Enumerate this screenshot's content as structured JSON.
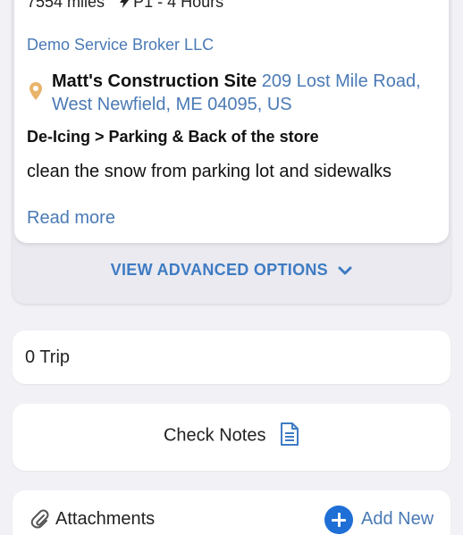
{
  "work_order": {
    "distance": "7554 miles",
    "priority": "P1 - 4 Hours",
    "broker": "Demo Service Broker LLC",
    "site_name": "Matt's Construction Site",
    "site_address": "209 Lost Mile Road, West Newfield, ME 04095, US",
    "service": "De-Icing > Parking & Back of the store",
    "description": "clean the snow from parking lot and sidewalks",
    "read_more": "Read more"
  },
  "advanced_options": {
    "label": "VIEW ADVANCED OPTIONS",
    "icon": "chevron-down-icon"
  },
  "trip": {
    "label": "0 Trip"
  },
  "notes": {
    "label": "Check Notes",
    "icon": "document-icon"
  },
  "attachments": {
    "label": "Attachments",
    "icon": "paperclip-icon",
    "add_label": "Add New",
    "add_icon": "plus-circle-icon"
  },
  "colors": {
    "link": "#4a7ab5",
    "accent": "#3f7bc3",
    "add_button": "#1f6fd6",
    "pin": "#e8b36a"
  }
}
